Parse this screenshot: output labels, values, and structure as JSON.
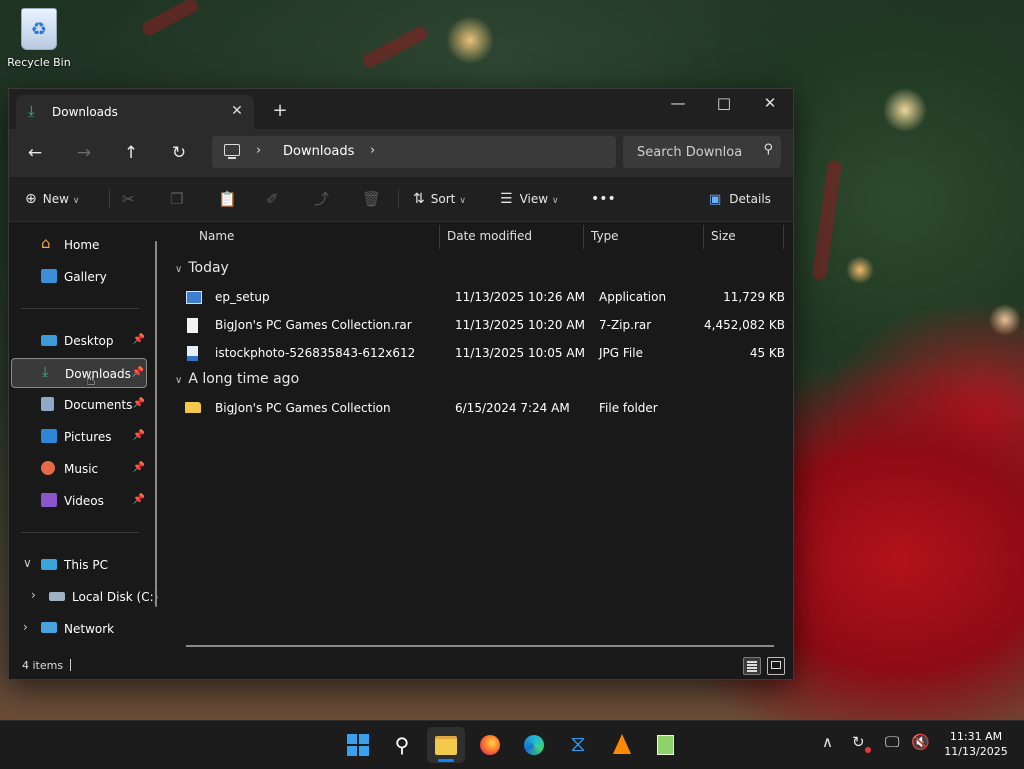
{
  "desktop": {
    "recycle_bin_label": "Recycle Bin"
  },
  "window": {
    "tab_title": "Downloads",
    "address": {
      "location": "Downloads"
    },
    "search": {
      "placeholder": "Search Downloa"
    },
    "toolbar": {
      "new_label": "New",
      "sort_label": "Sort",
      "view_label": "View",
      "more_label": "•••",
      "details_label": "Details"
    },
    "sidebar": {
      "items": [
        {
          "label": "Home"
        },
        {
          "label": "Gallery"
        },
        {
          "label": "Desktop"
        },
        {
          "label": "Downloads"
        },
        {
          "label": "Documents"
        },
        {
          "label": "Pictures"
        },
        {
          "label": "Music"
        },
        {
          "label": "Videos"
        },
        {
          "label": "This PC"
        },
        {
          "label": "Local Disk (C:)"
        },
        {
          "label": "Network"
        }
      ],
      "selected": "Downloads"
    },
    "columns": {
      "name": "Name",
      "date": "Date modified",
      "type": "Type",
      "size": "Size"
    },
    "groups": [
      {
        "label": "Today",
        "files": [
          {
            "name": "ep_setup",
            "date": "11/13/2025 10:26 AM",
            "type": "Application",
            "size": "11,729 KB",
            "icon": "application-icon"
          },
          {
            "name": "BigJon's PC Games Collection.rar",
            "date": "11/13/2025 10:20 AM",
            "type": "7-Zip.rar",
            "size": "4,452,082 KB",
            "icon": "archive-file-icon"
          },
          {
            "name": "istockphoto-526835843-612x612",
            "date": "11/13/2025 10:05 AM",
            "type": "JPG File",
            "size": "45 KB",
            "icon": "image-file-icon"
          }
        ]
      },
      {
        "label": "A long time ago",
        "files": [
          {
            "name": "BigJon's PC Games Collection",
            "date": "6/15/2024 7:24 AM",
            "type": "File folder",
            "size": "",
            "icon": "folder-icon"
          }
        ]
      }
    ],
    "status": {
      "item_count": "4 items"
    }
  },
  "taskbar": {
    "apps": [
      "start",
      "search",
      "file-explorer",
      "firefox",
      "edge",
      "vscode",
      "vlc",
      "notepad"
    ],
    "active_app": "file-explorer",
    "clock": {
      "time": "11:31 AM",
      "date": "11/13/2025"
    }
  },
  "colors": {
    "accent": "#0a84ff",
    "folder": "#f2c94c",
    "download_green": "#3fb27f"
  }
}
